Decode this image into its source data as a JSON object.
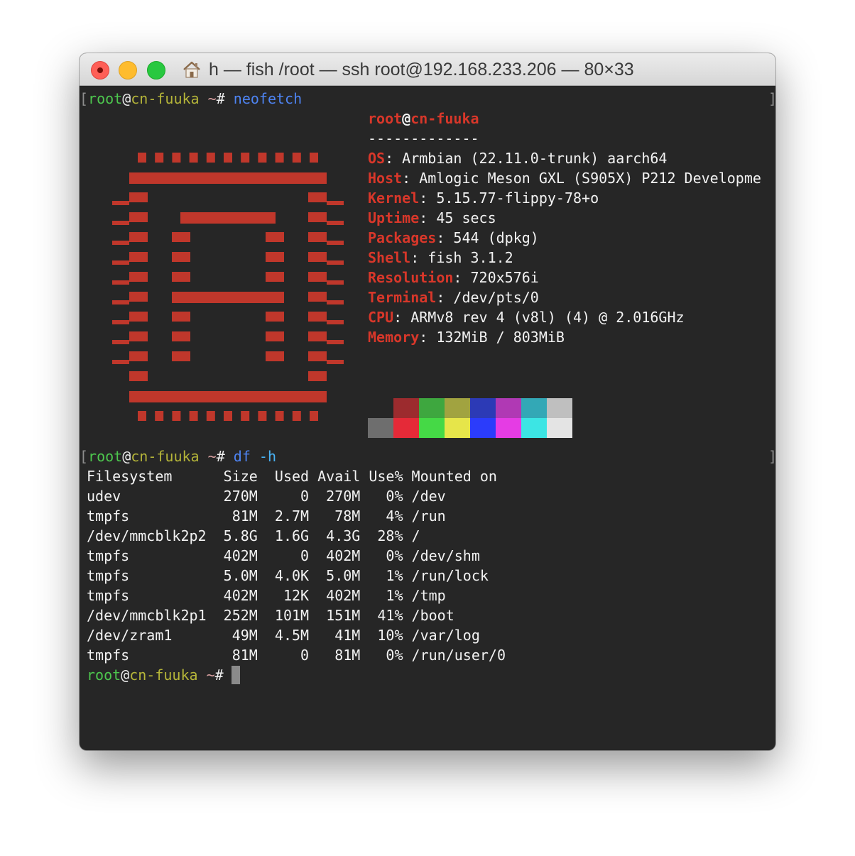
{
  "window": {
    "title": "h — fish /root — ssh root@192.168.233.206 — 80×33"
  },
  "prompt": {
    "user": "root",
    "at": "@",
    "host": "cn-fuuka",
    "tilde": "~",
    "hash": "#",
    "bracket_open": "[",
    "bracket_close": "]"
  },
  "commands": {
    "first": {
      "cmd": "neofetch",
      "args": ""
    },
    "second": {
      "cmd": "df",
      "args": "-h"
    }
  },
  "neofetch": {
    "user": "root",
    "at": "@",
    "host": "cn-fuuka",
    "underline": "-------------",
    "rows": [
      {
        "key": "OS",
        "value": ": Armbian (22.11.0-trunk) aarch64"
      },
      {
        "key": "Host",
        "value": ": Amlogic Meson GXL (S905X) P212 Developme"
      },
      {
        "key": "Kernel",
        "value": ": 5.15.77-flippy-78+o"
      },
      {
        "key": "Uptime",
        "value": ": 45 secs"
      },
      {
        "key": "Packages",
        "value": ": 544 (dpkg)"
      },
      {
        "key": "Shell",
        "value": ": fish 3.1.2"
      },
      {
        "key": "Resolution",
        "value": ": 720x576i"
      },
      {
        "key": "Terminal",
        "value": ": /dev/pts/0"
      },
      {
        "key": "CPU",
        "value": ": ARMv8 rev 4 (v8l) (4) @ 2.016GHz"
      },
      {
        "key": "Memory",
        "value": ": 132MiB / 803MiB"
      }
    ],
    "palette_row1": [
      "#262626",
      "#9c2b2e",
      "#3ea73f",
      "#a1a340",
      "#2c3ab6",
      "#b039b4",
      "#33a8b6",
      "#bfbfbf"
    ],
    "palette_row2": [
      "#6e6e6e",
      "#e52a38",
      "#45d946",
      "#e6e54a",
      "#2b3cfb",
      "#e53ce4",
      "#3ce5e4",
      "#e4e4e4"
    ],
    "logo_color": "#c0372b"
  },
  "df": {
    "header": "Filesystem      Size  Used Avail Use% Mounted on",
    "rows": [
      "udev            270M     0  270M   0% /dev",
      "tmpfs            81M  2.7M   78M   4% /run",
      "/dev/mmcblk2p2  5.8G  1.6G  4.3G  28% /",
      "tmpfs           402M     0  402M   0% /dev/shm",
      "tmpfs           5.0M  4.0K  5.0M   1% /run/lock",
      "tmpfs           402M   12K  402M   1% /tmp",
      "/dev/mmcblk2p1  252M  101M  151M  41% /boot",
      "/dev/zram1       49M  4.5M   41M  10% /var/log",
      "tmpfs            81M     0   81M   0% /run/user/0"
    ]
  }
}
